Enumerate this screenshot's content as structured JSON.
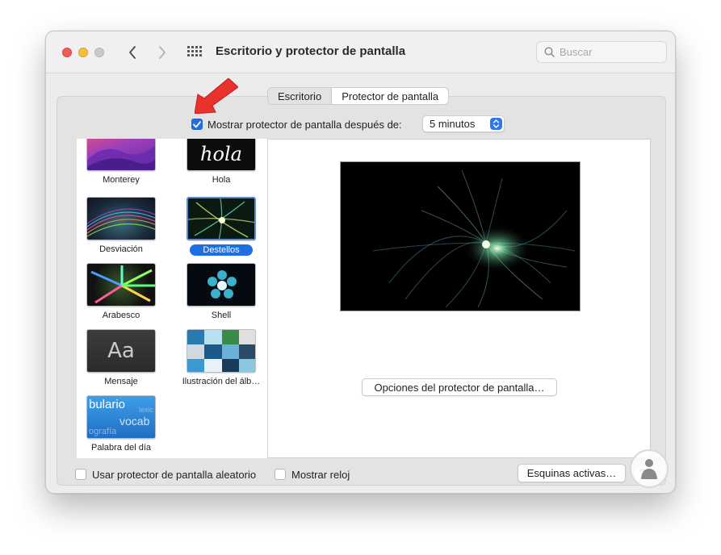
{
  "window": {
    "title": "Escritorio y protector de pantalla",
    "search_placeholder": "Buscar"
  },
  "tabs": [
    {
      "label": "Escritorio",
      "active": false
    },
    {
      "label": "Protector de pantalla",
      "active": true
    }
  ],
  "show_after": {
    "label": "Mostrar protector de pantalla después de:",
    "checked": true,
    "selected_value": "5 minutos"
  },
  "savers": [
    {
      "name": "Monterey",
      "selected": false
    },
    {
      "name": "Hola",
      "selected": false,
      "thumb_text": "hola"
    },
    {
      "name": "Desviación",
      "selected": false
    },
    {
      "name": "Destellos",
      "selected": true
    },
    {
      "name": "Arabesco",
      "selected": false
    },
    {
      "name": "Shell",
      "selected": false
    },
    {
      "name": "Mensaje",
      "selected": false,
      "thumb_text": "Aa"
    },
    {
      "name": "Ilustración del álb…",
      "selected": false
    },
    {
      "name": "Palabra del día",
      "selected": false,
      "thumb_words": [
        "bulario",
        "vocab",
        "ografía",
        "lexic"
      ]
    }
  ],
  "preview": {
    "options_button": "Opciones del protector de pantalla…"
  },
  "bottom": {
    "random_label": "Usar protector de pantalla aleatorio",
    "random_checked": false,
    "clock_label": "Mostrar reloj",
    "clock_checked": false,
    "hot_corners_button": "Esquinas activas…",
    "help_button": "?"
  },
  "annotation": {
    "arrow_color": "#e8322b"
  },
  "colors": {
    "accent": "#1f6fe4"
  }
}
